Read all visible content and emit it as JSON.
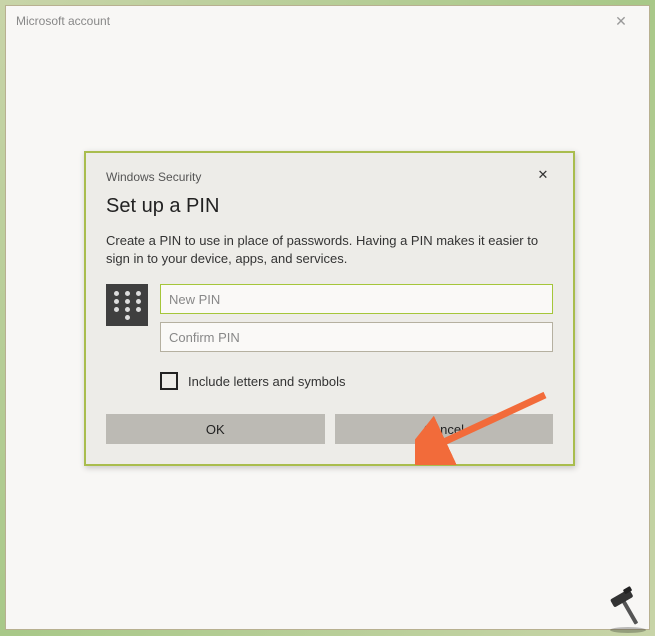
{
  "outer": {
    "title": "Microsoft account",
    "close": "✕"
  },
  "dialog": {
    "title": "Windows Security",
    "close": "✕",
    "heading": "Set up a PIN",
    "description": "Create a PIN to use in place of passwords. Having a PIN makes it easier to sign in to your device, apps, and services.",
    "newpin_placeholder": "New PIN",
    "confirm_placeholder": "Confirm PIN",
    "checkbox_label": "Include letters and symbols",
    "ok_label": "OK",
    "cancel_label": "Cancel"
  },
  "colors": {
    "accent": "#a9bd4e",
    "arrow": "#f26b3a"
  }
}
